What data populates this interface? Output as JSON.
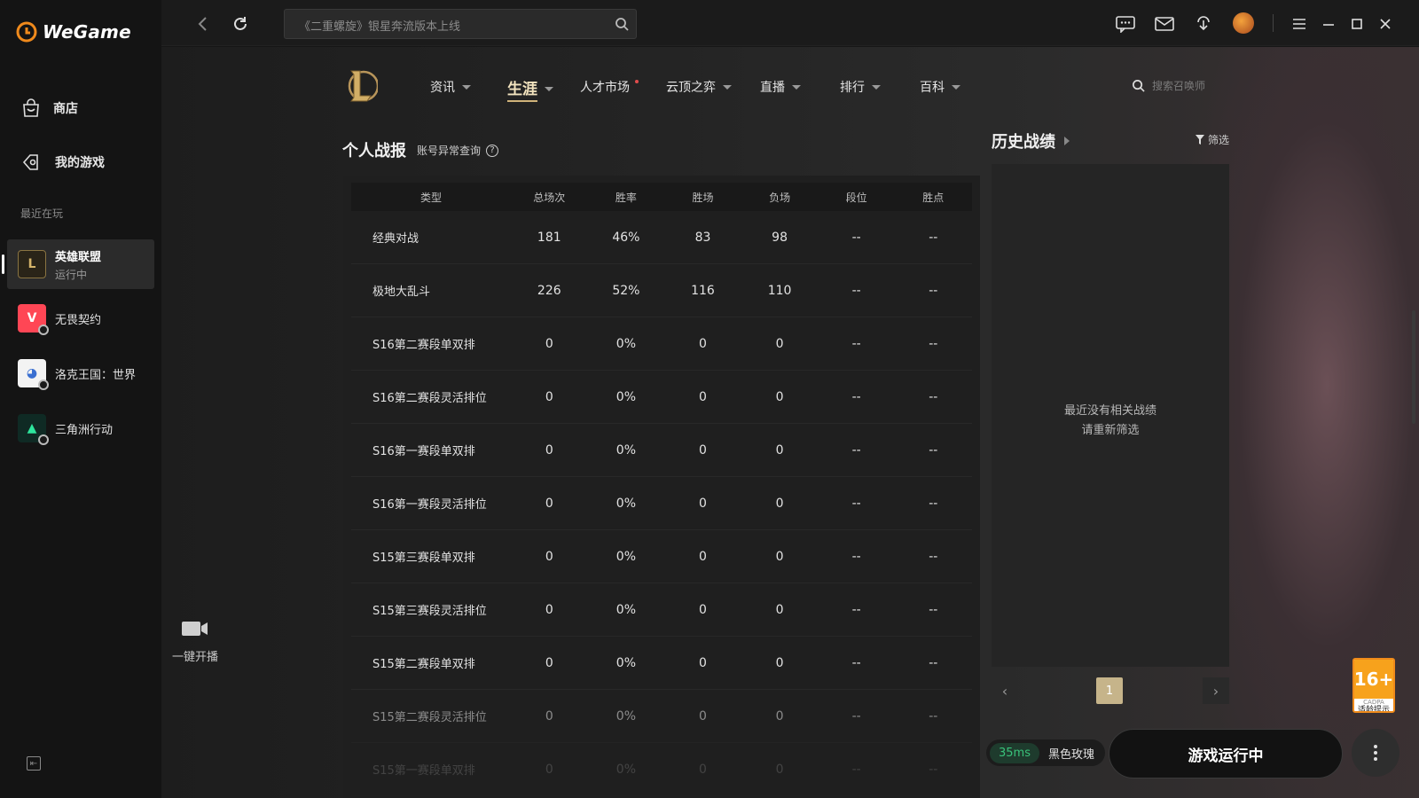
{
  "app": {
    "title": "WeGame"
  },
  "sidebar": {
    "nav": [
      {
        "label": "商店",
        "icon": "store-icon"
      },
      {
        "label": "我的游戏",
        "icon": "my-games-icon"
      }
    ],
    "recent_title": "最近在玩",
    "games": [
      {
        "name": "英雄联盟",
        "status": "运行中"
      },
      {
        "name": "无畏契约",
        "status": ""
      },
      {
        "name": "洛克王国：世界",
        "status": ""
      },
      {
        "name": "三角洲行动",
        "status": ""
      }
    ]
  },
  "stream": {
    "label": "一键开播"
  },
  "topbar": {
    "search_placeholder": "《二重螺旋》银星奔流版本上线"
  },
  "game_nav": {
    "items": [
      {
        "label": "资讯"
      },
      {
        "label": "生涯"
      },
      {
        "label": "人才市场"
      },
      {
        "label": "云顶之弈"
      },
      {
        "label": "直播"
      },
      {
        "label": "排行"
      },
      {
        "label": "百科"
      }
    ],
    "summoner_search_placeholder": "搜索召唤师"
  },
  "stats": {
    "title": "个人战报",
    "abnormal_link": "账号异常查询",
    "help": "?",
    "columns": [
      "类型",
      "总场次",
      "胜率",
      "胜场",
      "负场",
      "段位",
      "胜点"
    ],
    "rows": [
      [
        "经典对战",
        "181",
        "46%",
        "83",
        "98",
        "--",
        "--"
      ],
      [
        "极地大乱斗",
        "226",
        "52%",
        "116",
        "110",
        "--",
        "--"
      ],
      [
        "S16第二赛段单双排",
        "0",
        "0%",
        "0",
        "0",
        "--",
        "--"
      ],
      [
        "S16第二赛段灵活排位",
        "0",
        "0%",
        "0",
        "0",
        "--",
        "--"
      ],
      [
        "S16第一赛段单双排",
        "0",
        "0%",
        "0",
        "0",
        "--",
        "--"
      ],
      [
        "S16第一赛段灵活排位",
        "0",
        "0%",
        "0",
        "0",
        "--",
        "--"
      ],
      [
        "S15第三赛段单双排",
        "0",
        "0%",
        "0",
        "0",
        "--",
        "--"
      ],
      [
        "S15第三赛段灵活排位",
        "0",
        "0%",
        "0",
        "0",
        "--",
        "--"
      ],
      [
        "S15第二赛段单双排",
        "0",
        "0%",
        "0",
        "0",
        "--",
        "--"
      ],
      [
        "S15第二赛段灵活排位",
        "0",
        "0%",
        "0",
        "0",
        "--",
        "--"
      ],
      [
        "S15第一赛段单双排",
        "0",
        "0%",
        "0",
        "0",
        "--",
        "--"
      ]
    ]
  },
  "history": {
    "title": "历史战绩",
    "filter_label": "筛选",
    "empty_line1": "最近没有相关战绩",
    "empty_line2": "请重新筛选",
    "page": "1"
  },
  "bottom": {
    "ping": "35ms",
    "player_name": "黑色玫瑰",
    "launch_label": "游戏运行中",
    "age_rating": "16+",
    "age_sub": "CADPA",
    "age_hint": "适龄提示"
  },
  "colors": {
    "accent_gold": "#c6b48a",
    "ping_green": "#39c27a",
    "age_orange": "#f7a21c"
  }
}
